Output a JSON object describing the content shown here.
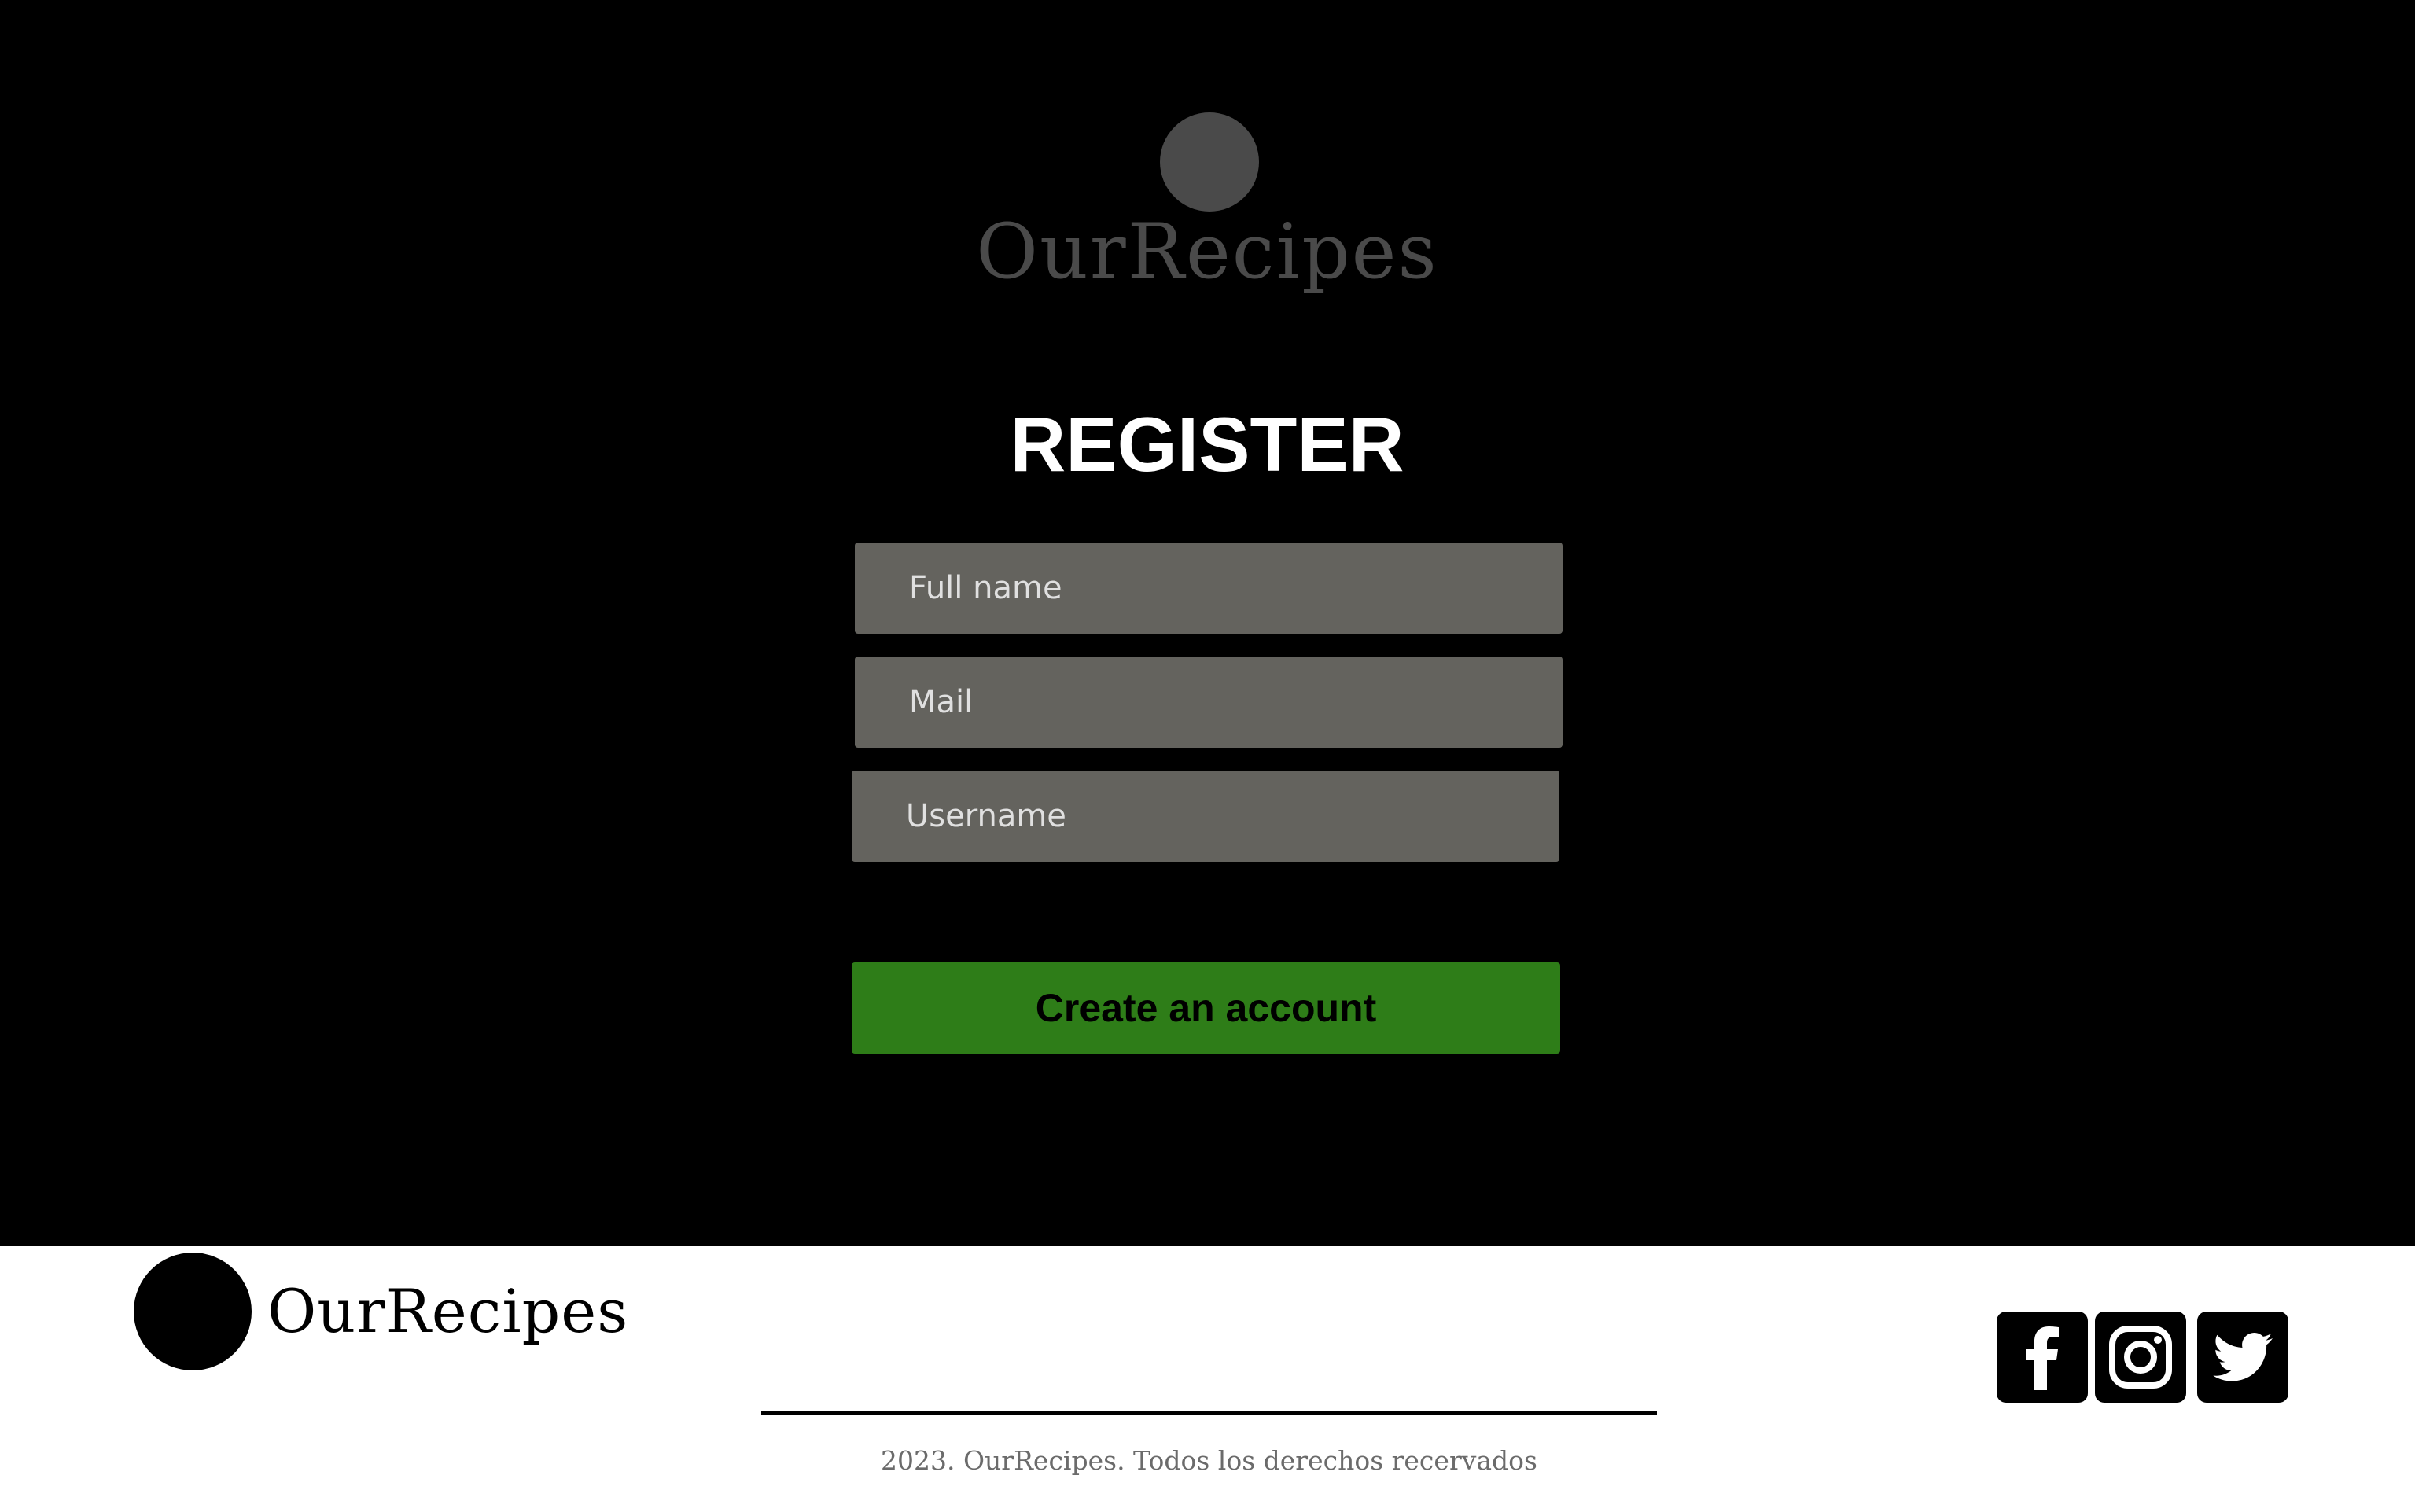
{
  "header": {
    "brand": "OurRecipes",
    "logo_icon": "circle-logo-icon"
  },
  "form": {
    "title": "REGISTER",
    "fields": [
      {
        "placeholder": "Full name",
        "value": ""
      },
      {
        "placeholder": "Mail",
        "value": ""
      },
      {
        "placeholder": "Username",
        "value": ""
      }
    ],
    "submit_label": "Create an account"
  },
  "footer": {
    "brand": "OurRecipes",
    "logo_icon": "circle-logo-icon",
    "social": [
      "facebook-icon",
      "instagram-icon",
      "twitter-icon"
    ],
    "copyright": "2023. OurRecipes. Todos los derechos recervados"
  },
  "colors": {
    "background": "#000000",
    "muted_brand": "#4a4a4a",
    "field_bg": "#64635e",
    "button_bg": "#2e7d18",
    "footer_bg": "#ffffff",
    "footer_text": "#6b6b6b"
  }
}
